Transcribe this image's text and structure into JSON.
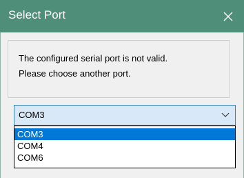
{
  "window": {
    "title": "Select Port",
    "close_icon": "close-icon"
  },
  "message": {
    "line1": "The configured serial port is not valid.",
    "line2": "Please choose another port."
  },
  "port_select": {
    "value": "COM3",
    "arrow_icon": "chevron-down-icon",
    "options": [
      {
        "label": "COM3",
        "selected": true
      },
      {
        "label": "COM4",
        "selected": false
      },
      {
        "label": "COM6",
        "selected": false
      }
    ]
  },
  "colors": {
    "titlebar": "#4f8f7a",
    "selection": "#0078d7",
    "combo_fill": "#d9e8f7",
    "combo_border": "#3c7fb1"
  }
}
